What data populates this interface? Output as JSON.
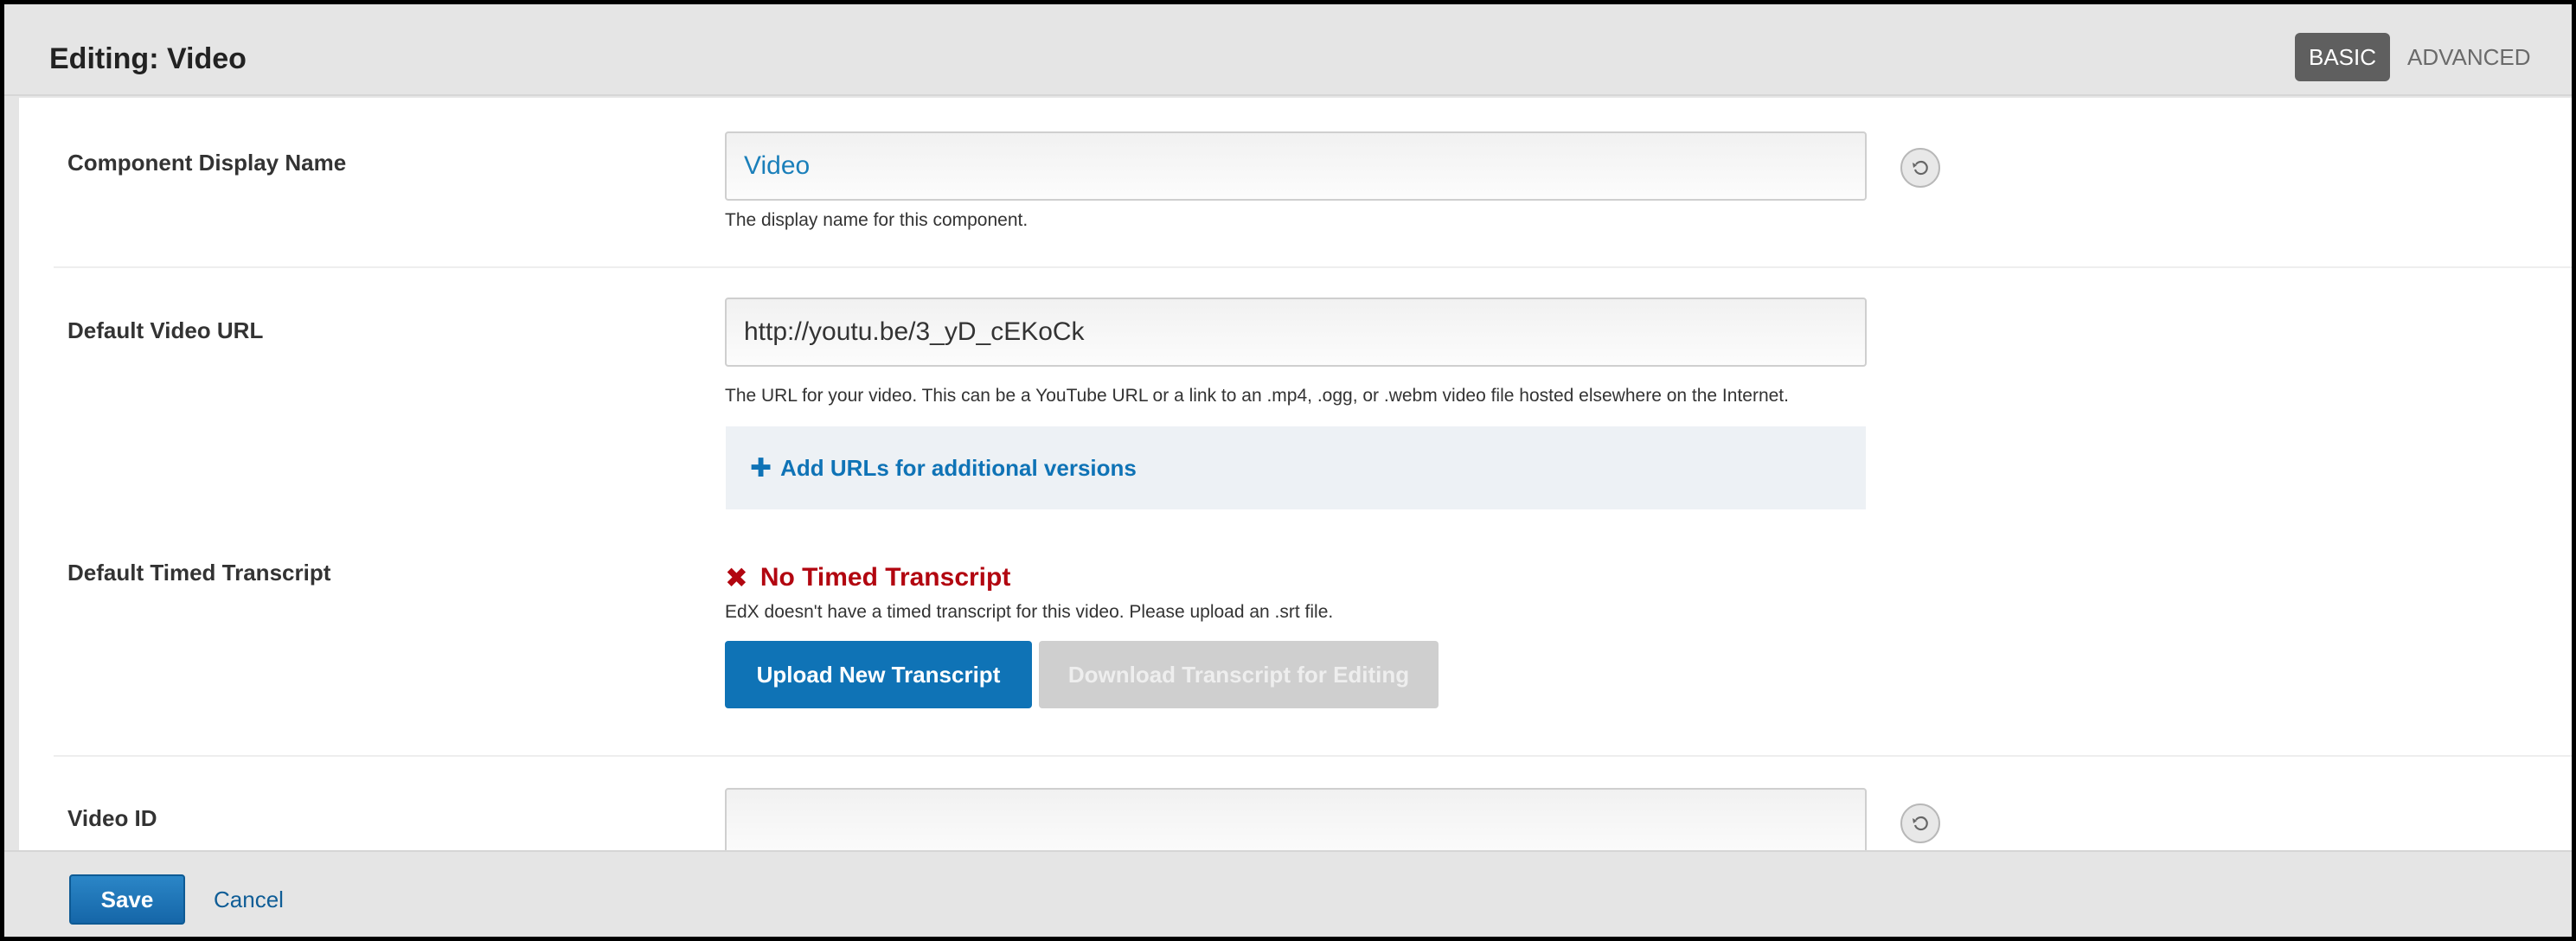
{
  "header": {
    "title": "Editing: Video",
    "mode_basic": "BASIC",
    "mode_advanced": "ADVANCED"
  },
  "fields": {
    "display_name": {
      "label": "Component Display Name",
      "value": "Video",
      "help": "The display name for this component."
    },
    "video_url": {
      "label": "Default Video URL",
      "value": "http://youtu.be/3_yD_cEKoCk",
      "help": "The URL for your video. This can be a YouTube URL or a link to an .mp4, .ogg, or .webm video file hosted elsewhere on the Internet.",
      "add_urls": "Add URLs for additional versions"
    },
    "transcript": {
      "label": "Default Timed Transcript",
      "status": "No Timed Transcript",
      "help": "EdX doesn't have a timed transcript for this video. Please upload an .srt file.",
      "upload_button": "Upload New Transcript",
      "download_button": "Download Transcript for Editing"
    },
    "video_id": {
      "label": "Video ID",
      "value": ""
    }
  },
  "footer": {
    "save": "Save",
    "cancel": "Cancel"
  },
  "colors": {
    "primary_blue": "#0f73b6",
    "error_red": "#b20610",
    "disabled_gray": "#cfcfcf"
  }
}
